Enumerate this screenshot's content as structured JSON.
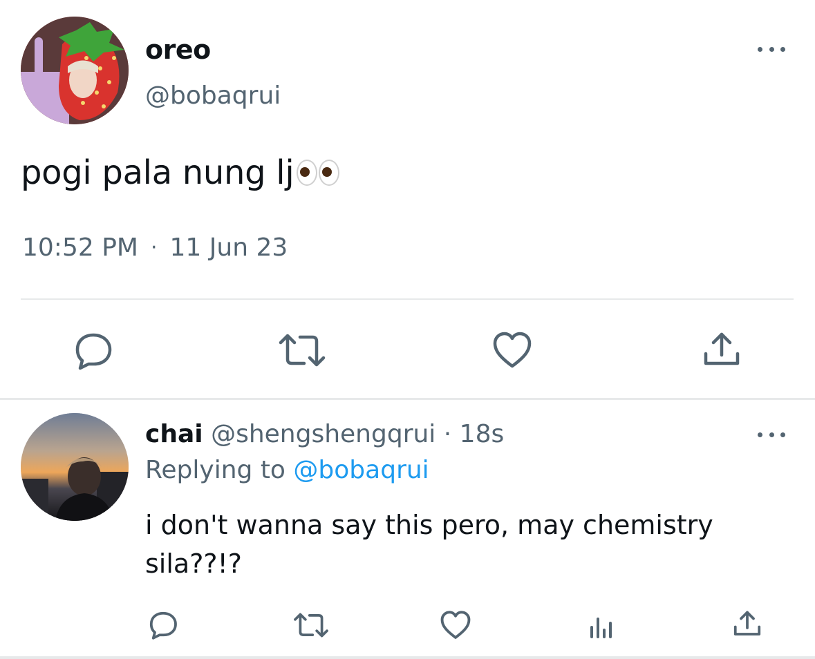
{
  "tweet": {
    "author_name": "oreo",
    "author_handle": "@bobaqrui",
    "text": "pogi pala nung lj",
    "time": "10:52 PM",
    "separator": "·",
    "date": "11 Jun 23"
  },
  "reply": {
    "author_name": "chai",
    "author_handle": "@shengshengqrui",
    "separator": "·",
    "age": "18s",
    "replying_prefix": "Replying to",
    "replying_handle": "@bobaqrui",
    "text": "i don't wanna say this pero, may chemistry sila??!?"
  },
  "icons": {
    "more": "more-horizontal-icon",
    "reply": "reply-icon",
    "retweet": "retweet-icon",
    "like": "heart-icon",
    "views": "views-icon",
    "share": "share-icon",
    "eyes": "eyes-emoji-icon"
  },
  "colors": {
    "text": "#0f1419",
    "secondary": "#536471",
    "link": "#1d9bf0",
    "divider": "#e7e9ea"
  }
}
